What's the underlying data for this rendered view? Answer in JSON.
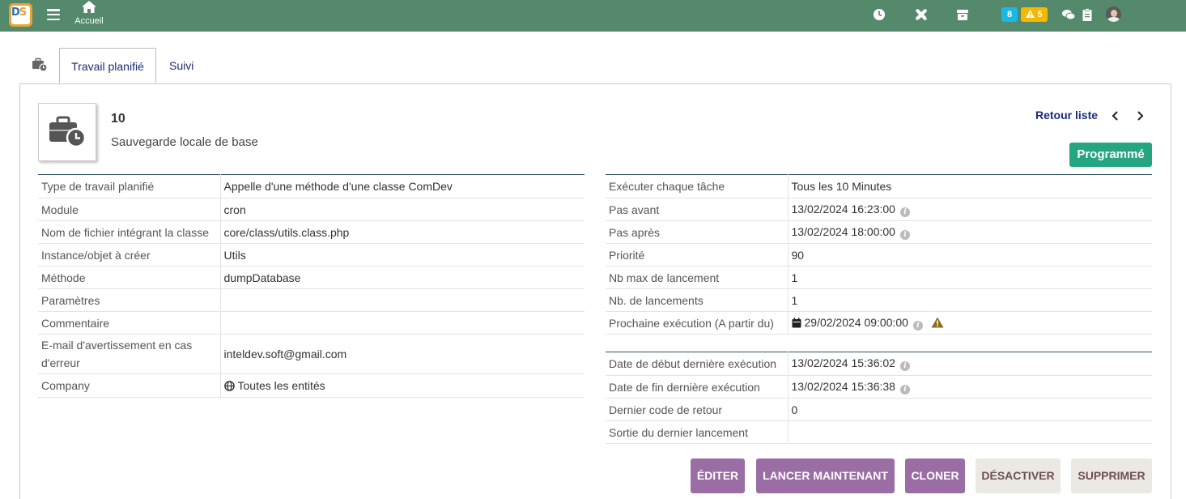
{
  "topbar": {
    "home_label": "Accueil",
    "badge_count_blue": "8",
    "badge_count_warning": "5",
    "icons": [
      "clock-icon",
      "tools-icon",
      "box-icon",
      "chat-icon",
      "clipboard-icon"
    ],
    "color": "#548a6b"
  },
  "tabs": [
    {
      "label": "Travail planifié",
      "active": true
    },
    {
      "label": "Suivi",
      "active": false
    }
  ],
  "header": {
    "ref": "10",
    "label": "Sauvegarde locale de base",
    "back_link": "Retour liste",
    "status": "Programmé",
    "status_color": "#25a580"
  },
  "left_fields": [
    {
      "key": "Type de travail planifié",
      "value": "Appelle d'une méthode d'une classe ComDev"
    },
    {
      "key": "Module",
      "value": "cron"
    },
    {
      "key": "Nom de fichier intégrant la classe",
      "value": "core/class/utils.class.php"
    },
    {
      "key": "Instance/objet à créer",
      "value": "Utils"
    },
    {
      "key": "Méthode",
      "value": "dumpDatabase"
    },
    {
      "key": "Paramètres",
      "value": ""
    },
    {
      "key": "Commentaire",
      "value": ""
    },
    {
      "key": "E-mail d'avertissement en cas d'erreur",
      "value": "inteldev.soft@gmail.com"
    },
    {
      "key": "Company",
      "value": "Toutes les entités"
    }
  ],
  "right_fields": [
    {
      "key": "Exécuter chaque tâche",
      "value": "Tous les 10 Minutes"
    },
    {
      "key": "Pas avant",
      "value": "13/02/2024 16:23:00"
    },
    {
      "key": "Pas après",
      "value": "13/02/2024 18:00:00"
    },
    {
      "key": "Priorité",
      "value": "90"
    },
    {
      "key": "Nb max de lancement",
      "value": "1"
    },
    {
      "key": "Nb. de lancements",
      "value": "1"
    },
    {
      "key": "Prochaine exécution (A partir du)",
      "value": "29/02/2024 09:00:00"
    }
  ],
  "right_fields2": [
    {
      "key": "Date de début dernière exécution",
      "value": "13/02/2024 15:36:02"
    },
    {
      "key": "Date de fin dernière exécution",
      "value": "13/02/2024 15:36:38"
    },
    {
      "key": "Dernier code de retour",
      "value": "0"
    },
    {
      "key": "Sortie du dernier lancement",
      "value": ""
    }
  ],
  "actions": {
    "edit": "ÉDITER",
    "run_now": "LANCER MAINTENANT",
    "clone": "CLONER",
    "disable": "DÉSACTIVER",
    "delete": "SUPPRIMER"
  }
}
